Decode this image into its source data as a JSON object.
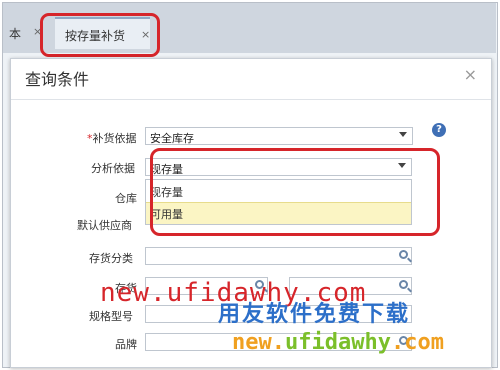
{
  "tabs": {
    "previous": {
      "label": "本",
      "close": "×"
    },
    "active": {
      "label": "按存量补货",
      "close": "×"
    }
  },
  "dialog": {
    "title": "查询条件",
    "close": "×",
    "help": "?",
    "fields": {
      "replenish_basis": {
        "required": "*",
        "label": "补货依据",
        "value": "安全库存"
      },
      "analysis_basis": {
        "label": "分析依据",
        "value": "现存量"
      },
      "warehouse": {
        "label": "仓库"
      },
      "default_supplier": {
        "label": "默认供应商"
      },
      "stock_category": {
        "label": "存货分类"
      },
      "stock": {
        "label": "存货"
      },
      "spec_model": {
        "label": "规格型号"
      },
      "brand": {
        "label": "品牌"
      }
    },
    "dropdown_options": [
      "现存量",
      "可用量"
    ],
    "dropdown_selected": "可用量"
  },
  "watermark": {
    "url_red": "new.ufidawhy.com",
    "brand": "用友软件免费下载",
    "url_bottom_a": "new.",
    "url_bottom_b": "ufidawhy",
    "url_bottom_c": ".com"
  }
}
